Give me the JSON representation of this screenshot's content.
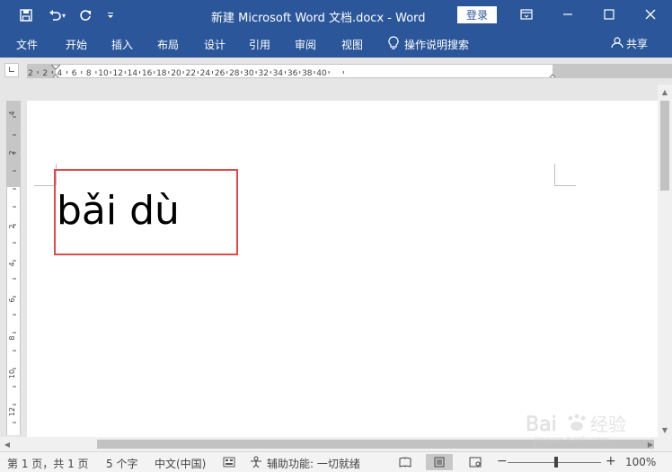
{
  "titlebar": {
    "document_title": "新建 Microsoft Word 文档.docx - Word",
    "login_label": "登录",
    "quick_access_icons": [
      "save-icon",
      "undo-icon",
      "redo-icon",
      "customize-icon"
    ],
    "window_controls": [
      "ribbon-display-icon",
      "minimize-icon",
      "maximize-icon",
      "close-icon"
    ]
  },
  "menu": {
    "tabs": [
      "文件",
      "开始",
      "插入",
      "布局",
      "设计",
      "引用",
      "审阅",
      "视图"
    ],
    "tell_me": "操作说明搜索",
    "share": "共享"
  },
  "rulers": {
    "horizontal_labels": [
      "2",
      "2",
      "4",
      "6",
      "8",
      "10",
      "12",
      "14",
      "16",
      "18",
      "20",
      "22",
      "24",
      "26",
      "28",
      "30",
      "32",
      "34",
      "36",
      "38",
      "40"
    ],
    "vertical_labels": [
      "4",
      "2",
      "2",
      "4",
      "6",
      "8",
      "10",
      "12"
    ]
  },
  "document": {
    "text": "bǎi dù"
  },
  "statusbar": {
    "page_info": "第 1 页，共 1 页",
    "word_count": "5 个字",
    "language": "中文(中国)",
    "accessibility": "辅助功能: 一切就绪",
    "zoom": "100%",
    "zoom_minus": "−",
    "zoom_plus": "+"
  },
  "watermark": {
    "text": "Bai经验",
    "sub": "jingyan.baidu.com"
  },
  "colors": {
    "ribbon_blue": "#2b579a",
    "highlight_red": "#e04a4a"
  }
}
